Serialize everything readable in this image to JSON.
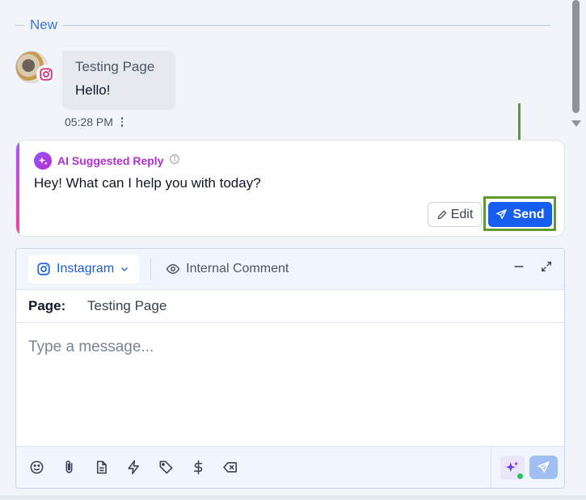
{
  "divider": {
    "label": "New"
  },
  "message": {
    "sender": "Testing Page",
    "text": "Hello!",
    "time": "05:28 PM",
    "channel_icon": "instagram-icon"
  },
  "ai_suggestion": {
    "title": "AI Suggested Reply",
    "text": "Hey! What can I help you with today?",
    "edit_label": "Edit",
    "send_label": "Send",
    "accent_color": "#b02fd0"
  },
  "composer": {
    "channel": "Instagram",
    "internal_tab": "Internal Comment",
    "page_label": "Page:",
    "page_value": "Testing Page",
    "placeholder": "Type a message...",
    "toolbar_icons": [
      "emoji-icon",
      "attachment-icon",
      "document-icon",
      "lightning-icon",
      "tag-icon",
      "dollar-icon",
      "clear-icon"
    ]
  },
  "colors": {
    "primary": "#155eef",
    "highlight": "#5f9a2f",
    "link": "#1d5fd8"
  }
}
